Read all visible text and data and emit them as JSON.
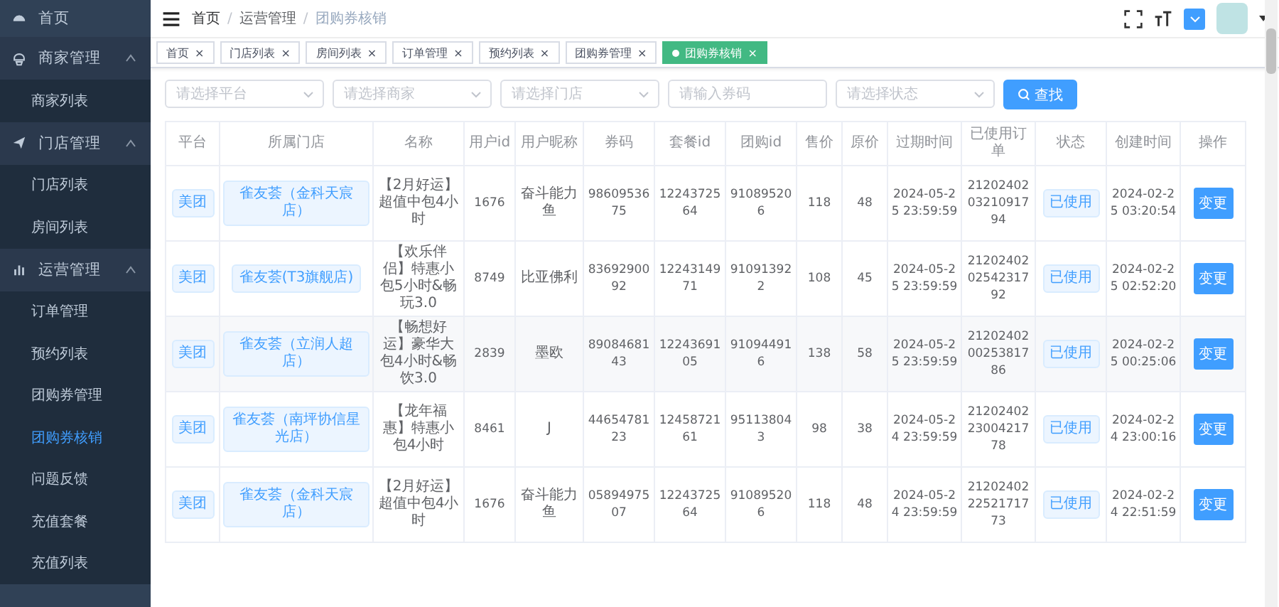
{
  "sidebar": {
    "items": [
      {
        "label": "首页"
      },
      {
        "label": "商家管理",
        "expanded": true,
        "children": [
          {
            "label": "商家列表",
            "selected": false
          }
        ]
      },
      {
        "label": "门店管理",
        "expanded": true,
        "children": [
          {
            "label": "门店列表",
            "selected": false
          },
          {
            "label": "房间列表",
            "selected": false
          }
        ]
      },
      {
        "label": "运营管理",
        "expanded": true,
        "children": [
          {
            "label": "订单管理",
            "selected": false
          },
          {
            "label": "预约列表",
            "selected": false
          },
          {
            "label": "团购券管理",
            "selected": false
          },
          {
            "label": "团购券核销",
            "selected": true
          },
          {
            "label": "问题反馈",
            "selected": false
          },
          {
            "label": "充值套餐",
            "selected": false
          },
          {
            "label": "充值列表",
            "selected": false
          }
        ]
      }
    ]
  },
  "breadcrumb": [
    {
      "label": "首页"
    },
    {
      "separator": "/",
      "label": "运营管理"
    },
    {
      "separator": "/",
      "label": "团购券核销"
    }
  ],
  "tabs": [
    {
      "label": "首页",
      "close": "×",
      "selected": false
    },
    {
      "label": "门店列表",
      "close": "×",
      "selected": false
    },
    {
      "label": "房间列表",
      "close": "×",
      "selected": false
    },
    {
      "label": "订单管理",
      "close": "×",
      "selected": false
    },
    {
      "label": "预约列表",
      "close": "×",
      "selected": false
    },
    {
      "label": "团购券管理",
      "close": "×",
      "selected": false
    },
    {
      "label": "团购券核销",
      "close": "×",
      "selected": true
    }
  ],
  "filters": [
    {
      "kind": "select",
      "placeholder": "请选择平台"
    },
    {
      "kind": "select",
      "placeholder": "请选择商家"
    },
    {
      "kind": "select",
      "placeholder": "请选择门店"
    },
    {
      "kind": "input",
      "placeholder": "请输入券码"
    },
    {
      "kind": "select",
      "placeholder": "请选择状态"
    }
  ],
  "search_button": "查找",
  "table": {
    "columns": [
      "平台",
      "所属门店",
      "名称",
      "用户id",
      "用户昵称",
      "券码",
      "套餐id",
      "团购id",
      "售价",
      "原价",
      "过期时间",
      "已使用订单",
      "状态",
      "创建时间",
      "操作"
    ],
    "rows": [
      {
        "platform": "美团",
        "store": "雀友荟（金科天宸店）",
        "name": "【2月好运】超值中包4小时",
        "user_id": "1676",
        "nickname": "奋斗能力鱼",
        "code": "9860953675",
        "package_id": "1224372564",
        "group_id": "910895206",
        "price": "118",
        "original_price": "48",
        "expire": "2024-05-25 23:59:59",
        "order": "212024020321091794",
        "status": "已使用",
        "created": "2024-02-25 03:20:54",
        "action": "变更"
      },
      {
        "platform": "美团",
        "store": "雀友荟(T3旗舰店)",
        "name": "【欢乐伴侣】特惠小包5小时&畅玩3.0",
        "user_id": "8749",
        "nickname": "比亚佛利",
        "code": "8369290092",
        "package_id": "1224314971",
        "group_id": "910913922",
        "price": "108",
        "original_price": "45",
        "expire": "2024-05-25 23:59:59",
        "order": "212024020254231792",
        "status": "已使用",
        "created": "2024-02-25 02:52:20",
        "action": "变更"
      },
      {
        "platform": "美团",
        "store": "雀友荟（立润人超店）",
        "name": "【畅想好运】豪华大包4小时&畅饮3.0",
        "user_id": "2839",
        "nickname": "墨欧",
        "code": "8908468143",
        "package_id": "1224369105",
        "group_id": "910944916",
        "price": "138",
        "original_price": "58",
        "expire": "2024-05-25 23:59:59",
        "order": "212024020025381786",
        "status": "已使用",
        "created": "2024-02-25 00:25:06",
        "action": "变更"
      },
      {
        "platform": "美团",
        "store": "雀友荟（南坪协信星光店）",
        "name": "【龙年福惠】特惠小包4小时",
        "user_id": "8461",
        "nickname": "J",
        "code": "4465478123",
        "package_id": "1245872161",
        "group_id": "951138043",
        "price": "98",
        "original_price": "38",
        "expire": "2024-05-24 23:59:59",
        "order": "212024022300421778",
        "status": "已使用",
        "created": "2024-02-24 23:00:16",
        "action": "变更"
      },
      {
        "platform": "美团",
        "store": "雀友荟（金科天宸店）",
        "name": "【2月好运】超值中包4小时",
        "user_id": "1676",
        "nickname": "奋斗能力鱼",
        "code": "0589497507",
        "package_id": "1224372564",
        "group_id": "910895206",
        "price": "118",
        "original_price": "48",
        "expire": "2024-05-24 23:59:59",
        "order": "212024022252171773",
        "status": "已使用",
        "created": "2024-02-24 22:51:59",
        "action": "变更"
      }
    ]
  }
}
